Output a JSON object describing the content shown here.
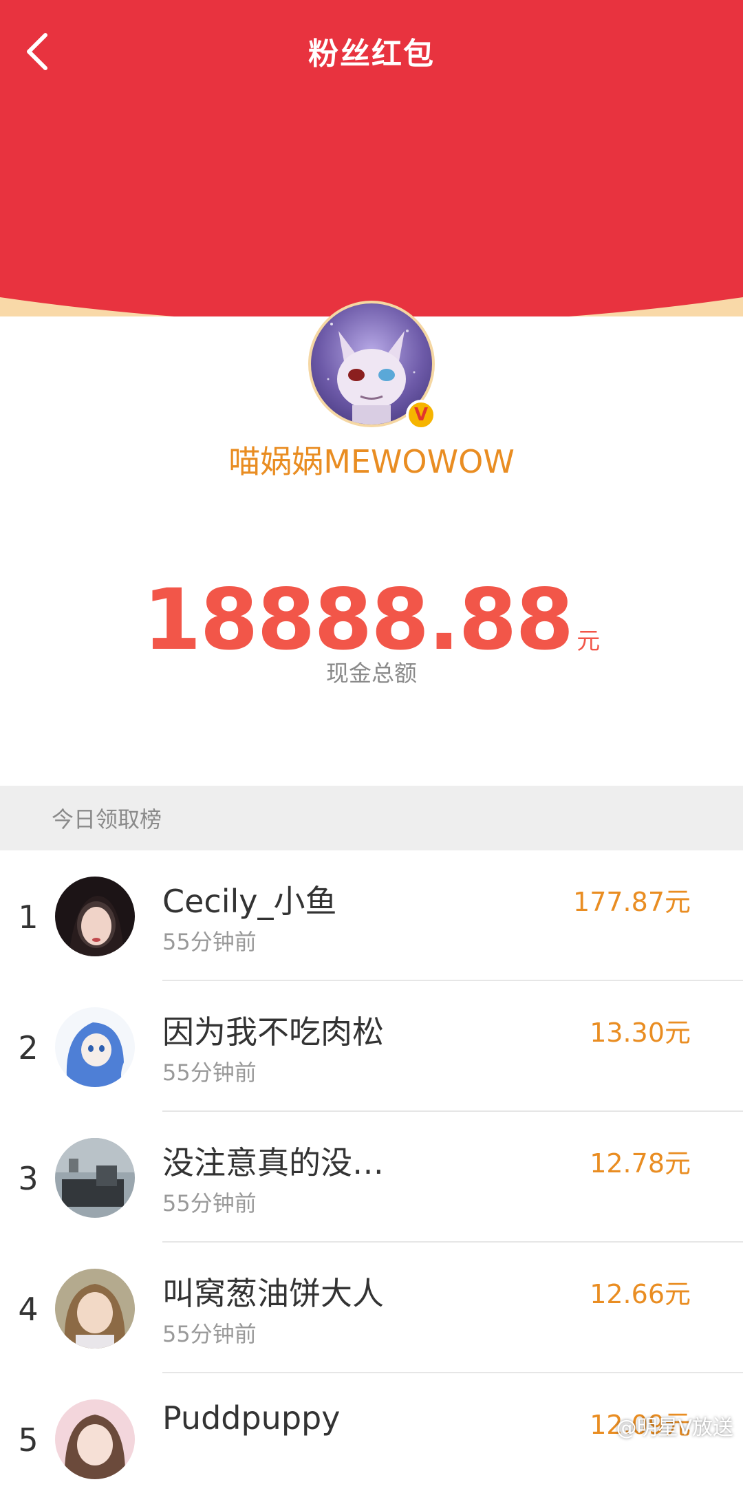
{
  "header": {
    "title": "粉丝红包",
    "back_icon": "chevron-left-icon",
    "color_red": "#e8333f",
    "color_rim": "#f9d9a8"
  },
  "profile": {
    "username": "喵娲娲MEWOWOW",
    "verified_badge": "V",
    "amount": "18888.88",
    "amount_unit": "元",
    "amount_label": "现金总额"
  },
  "ranking": {
    "section_title": "今日领取榜",
    "items": [
      {
        "rank": "1",
        "name": "Cecily_小鱼",
        "time": "55分钟前",
        "amount": "177.87元"
      },
      {
        "rank": "2",
        "name": "因为我不吃肉松",
        "time": "55分钟前",
        "amount": "13.30元"
      },
      {
        "rank": "3",
        "name": "没注意真的没…",
        "time": "55分钟前",
        "amount": "12.78元"
      },
      {
        "rank": "4",
        "name": "叫窝葱油饼大人",
        "time": "55分钟前",
        "amount": "12.66元"
      },
      {
        "rank": "5",
        "name": "Puddpuppy",
        "time": "",
        "amount": "12.09元"
      }
    ]
  },
  "watermark": "@明星V放送"
}
